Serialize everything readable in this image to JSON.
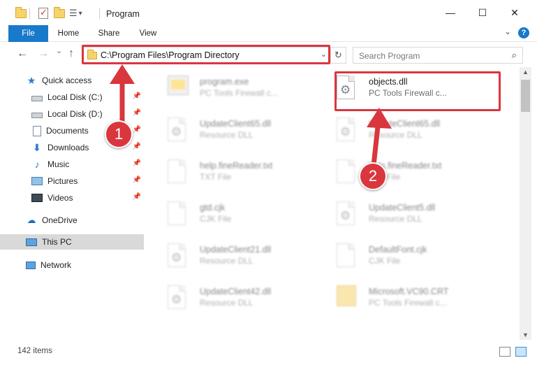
{
  "window": {
    "title": "Program",
    "minimize_glyph": "—",
    "maximize_glyph": "☐",
    "close_glyph": "✕",
    "dropdown_glyph": "▾"
  },
  "ribbon": {
    "tabs": [
      {
        "label": "File",
        "active": true
      },
      {
        "label": "Home"
      },
      {
        "label": "Share"
      },
      {
        "label": "View"
      }
    ],
    "expand_glyph": "⌄",
    "help_glyph": "?"
  },
  "nav": {
    "back_glyph": "←",
    "forward_glyph": "→",
    "recent_glyph": "⌄",
    "up_glyph": "↑",
    "address": "C:\\Program Files\\Program Directory",
    "address_drop_glyph": "⌄",
    "refresh_glyph": "↻",
    "search_placeholder": "Search Program",
    "search_glyph": "⌕"
  },
  "sidebar": {
    "quick_access": "Quick access",
    "pinned": [
      {
        "label": "Local Disk (C:)",
        "icon": "disk-icon"
      },
      {
        "label": "Local Disk (D:)",
        "icon": "disk-icon"
      },
      {
        "label": "Documents",
        "icon": "documents-icon"
      },
      {
        "label": "Downloads",
        "icon": "downloads-icon"
      },
      {
        "label": "Music",
        "icon": "music-icon"
      },
      {
        "label": "Pictures",
        "icon": "pictures-icon"
      },
      {
        "label": "Videos",
        "icon": "videos-icon"
      }
    ],
    "pin_glyph": "📌",
    "onedrive": "OneDrive",
    "this_pc": "This PC",
    "network": "Network"
  },
  "files": [
    {
      "name": "program.exe",
      "type": "PC Tools Firewall c...",
      "icon": "exe-icon",
      "blurred": true
    },
    {
      "name": "objects.dll",
      "type": "PC Tools Firewall c...",
      "icon": "dll-gear-icon",
      "blurred": false
    },
    {
      "name": "UpdateClient65.dll",
      "type": "Resource DLL",
      "icon": "dll-gear-icon",
      "blurred": true
    },
    {
      "name": "UpdateClient65.dll",
      "type": "Resource DLL",
      "icon": "dll-gear-icon",
      "blurred": true
    },
    {
      "name": "help.fineReader.txt",
      "type": "TXT File",
      "icon": "txt-icon",
      "blurred": true
    },
    {
      "name": "help.fineReader.txt",
      "type": "TXT File",
      "icon": "txt-icon",
      "blurred": true
    },
    {
      "name": "gtd.cjk",
      "type": "CJK File",
      "icon": "cjk-icon",
      "blurred": true
    },
    {
      "name": "UpdateClient5.dll",
      "type": "Resource DLL",
      "icon": "dll-gear-icon",
      "blurred": true
    },
    {
      "name": "UpdateClient21.dll",
      "type": "Resource DLL",
      "icon": "dll-gear-icon",
      "blurred": true
    },
    {
      "name": "DefaultFont.cjk",
      "type": "CJK File",
      "icon": "cjk-icon",
      "blurred": true
    },
    {
      "name": "UpdateClient42.dll",
      "type": "Resource DLL",
      "icon": "dll-gear-icon",
      "blurred": true
    },
    {
      "name": "Microsoft.VC90.CRT",
      "type": "PC Tools Firewall c...",
      "icon": "folder-icon",
      "blurred": true
    }
  ],
  "status": {
    "item_count": "142 items"
  },
  "annotations": {
    "step1": "1",
    "step2": "2",
    "color": "#d9363e"
  }
}
